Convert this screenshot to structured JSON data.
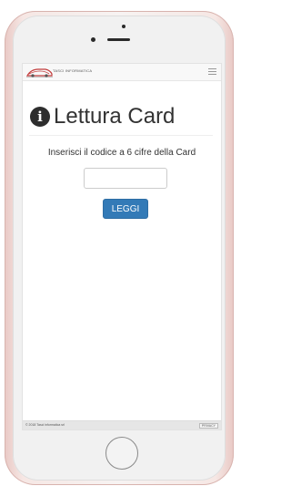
{
  "navbar": {
    "logo_text": "TASCI INFORMATICA"
  },
  "page": {
    "title": "Lettura Card",
    "instruction": "Inserisci il codice a 6 cifre della Card",
    "code_value": "",
    "button_label": "LEGGI"
  },
  "footer": {
    "copyright": "© 2018 Tasci informatica srl",
    "privacy": "PRIVACY"
  },
  "colors": {
    "primary": "#337ab7",
    "title": "#333333",
    "phone_frame": "#f6e7e4"
  },
  "icons": [
    "info-icon",
    "hamburger-menu-icon",
    "car-logo-icon"
  ]
}
